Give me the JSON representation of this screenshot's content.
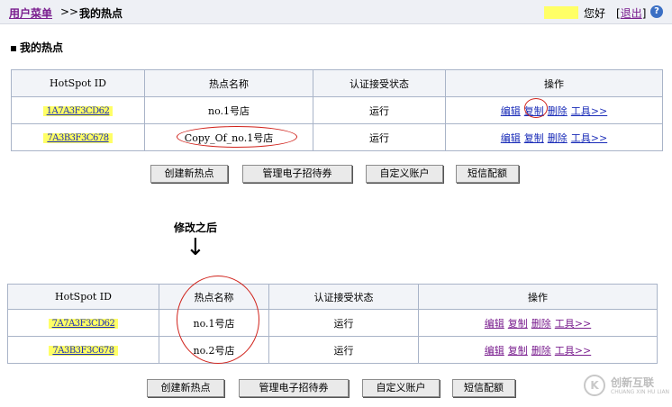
{
  "header": {
    "crumb_link": "用户菜单",
    "crumb_sep": ">>",
    "crumb_current": "我的热点",
    "hello": "您好",
    "logout": "退出",
    "logout_open": "[",
    "logout_close": "]",
    "help": "?"
  },
  "section_title": "我的热点",
  "table_headers": [
    "HotSpot ID",
    "热点名称",
    "认证接受状态",
    "操作"
  ],
  "table_before": {
    "rows": [
      {
        "id": "1A7A3F3CD62",
        "name": "no.1号店",
        "status": "运行"
      },
      {
        "id": "7A3B3F3C678",
        "name": "Copy_Of_no.1号店",
        "status": "运行"
      }
    ]
  },
  "table_after": {
    "rows": [
      {
        "id": "7A7A3F3CD62",
        "name": "no.1号店",
        "status": "运行"
      },
      {
        "id": "7A3B3F3C678",
        "name": "no.2号店",
        "status": "运行"
      }
    ]
  },
  "actions": {
    "edit": "编辑",
    "copy": "复制",
    "delete": "删除",
    "tools": "工具>>"
  },
  "buttons": {
    "create": "创建新热点",
    "coupons": "管理电子招待券",
    "accounts": "自定义账户",
    "sms": "短信配额"
  },
  "after_label": "修改之后",
  "arrow": "↓",
  "watermark": {
    "logo": "K",
    "text": "创新互联",
    "sub": "CHUANG XIN HU LIAN"
  },
  "colors": {
    "highlight": "#ffff66",
    "link": "#1a2cb8",
    "visited": "#7a1e8f",
    "annotation": "#d0221b"
  }
}
